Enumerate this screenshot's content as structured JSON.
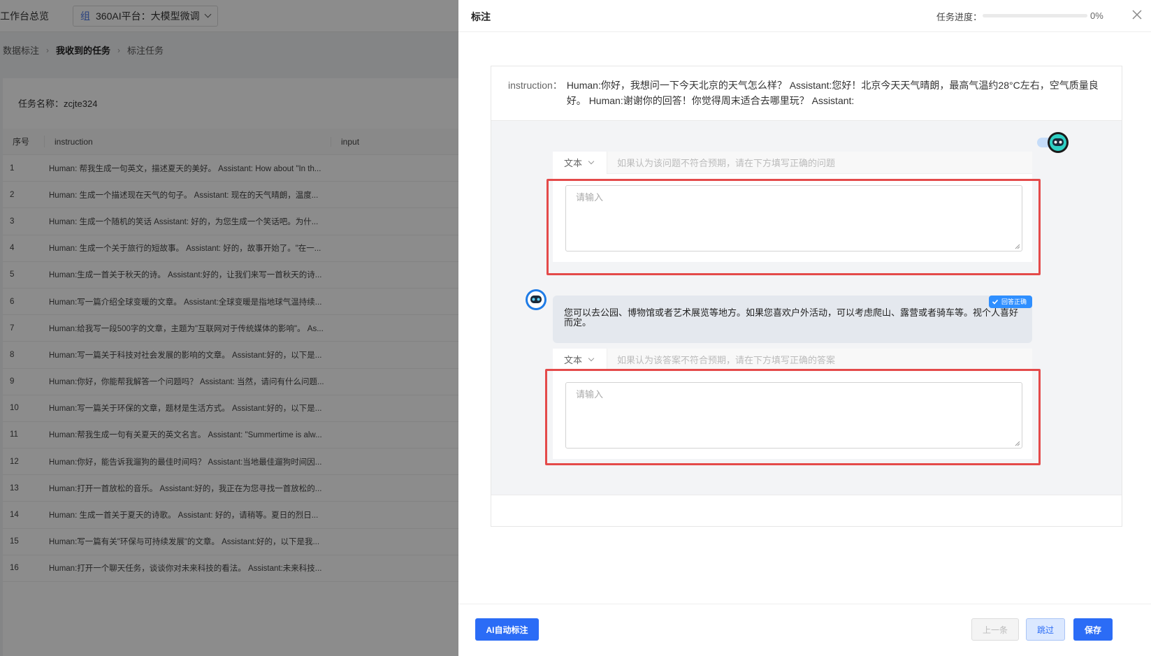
{
  "background": {
    "workspace_title": "工作台总览",
    "platform_tag": "组",
    "platform_name": "360AI平台：大模型微调",
    "breadcrumb": [
      "数据标注",
      "我收到的任务",
      "标注任务"
    ],
    "task_name": "任务名称：zcjte324",
    "table": {
      "headers": [
        "序号",
        "instruction",
        "input"
      ],
      "rows": [
        {
          "index": "1",
          "instruction": "Human: 帮我生成一句英文，描述夏天的美好。 Assistant: How about \"In th..."
        },
        {
          "index": "2",
          "instruction": "Human: 生成一个描述现在天气的句子。 Assistant: 现在的天气晴朗，温度..."
        },
        {
          "index": "3",
          "instruction": "Human: 生成一个随机的笑话 Assistant: 好的，为您生成一个笑话吧。为什..."
        },
        {
          "index": "4",
          "instruction": "Human: 生成一个关于旅行的短故事。 Assistant: 好的，故事开始了。\"在一..."
        },
        {
          "index": "5",
          "instruction": "Human:生成一首关于秋天的诗。 Assistant:好的，让我们来写一首秋天的诗..."
        },
        {
          "index": "6",
          "instruction": "Human:写一篇介绍全球变暖的文章。 Assistant:全球变暖是指地球气温持续..."
        },
        {
          "index": "7",
          "instruction": "Human:给我写一段500字的文章，主题为\"互联网对于传统媒体的影响\"。 As..."
        },
        {
          "index": "8",
          "instruction": "Human:写一篇关于科技对社会发展的影响的文章。 Assistant:好的，以下是..."
        },
        {
          "index": "9",
          "instruction": "Human:你好，你能帮我解答一个问题吗？ Assistant: 当然，请问有什么问题..."
        },
        {
          "index": "10",
          "instruction": "Human:写一篇关于环保的文章，题材是生活方式。 Assistant:好的，以下是..."
        },
        {
          "index": "11",
          "instruction": "Human:帮我生成一句有关夏天的英文名言。 Assistant: \"Summertime is alw..."
        },
        {
          "index": "12",
          "instruction": "Human:你好，能告诉我遛狗的最佳时间吗？ Assistant:当地最佳遛狗时间因..."
        },
        {
          "index": "13",
          "instruction": "Human:打开一首放松的音乐。 Assistant:好的，我正在为您寻找一首放松的..."
        },
        {
          "index": "14",
          "instruction": "Human: 生成一首关于夏天的诗歌。 Assistant: 好的，请稍等。夏日的烈日..."
        },
        {
          "index": "15",
          "instruction": "Human:写一篇有关\"环保与可持续发展\"的文章。 Assistant:好的，以下是我..."
        },
        {
          "index": "16",
          "instruction": "Human:打开一个聊天任务，谈谈你对未来科技的看法。 Assistant:未来科技..."
        }
      ]
    }
  },
  "drawer": {
    "title": "标注",
    "progress_label": "任务进度：",
    "progress_value": 0,
    "progress_text": "0%",
    "instruction_label": "instruction：",
    "instruction_text": "Human:你好，我想问一下今天北京的天气怎么样？ Assistant:您好！北京今天天气晴朗，最高气温约28°C左右，空气质量良好。 Human:谢谢你的回答！你觉得周末适合去哪里玩？ Assistant:",
    "question_block": {
      "type_label": "文本",
      "hint": "如果认为该问题不符合预期，请在下方填写正确的问题",
      "placeholder": "请输入"
    },
    "answer_text": "您可以去公园、博物馆或者艺术展览等地方。如果您喜欢户外活动，可以考虑爬山、露营或者骑车等。视个人喜好而定。",
    "answer_badge": "回答正确",
    "answer_block": {
      "type_label": "文本",
      "hint": "如果认为该答案不符合预期，请在下方填写正确的答案",
      "placeholder": "请输入"
    },
    "buttons": {
      "ai_label": "AI自动标注",
      "prev_label": "上一条",
      "skip_label": "跳过",
      "save_label": "保存"
    }
  },
  "colors": {
    "primary": "#2b6cf6",
    "highlight_border": "#e44a4a"
  }
}
